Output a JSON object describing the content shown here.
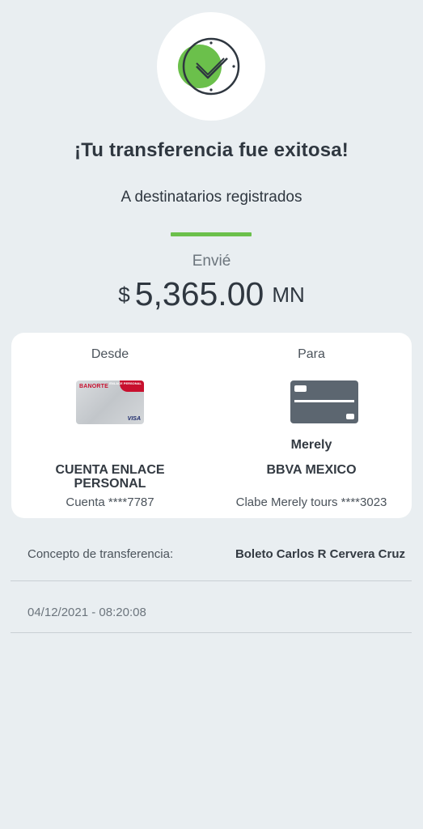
{
  "status": {
    "icon": "success-check-icon",
    "title": "¡Tu transferencia fue exitosa!",
    "subtitle": "A destinatarios registrados"
  },
  "amount": {
    "label": "Envié",
    "currency_symbol": "$",
    "value": "5,365.00",
    "unit": "MN"
  },
  "from": {
    "header": "Desde",
    "card_brand": "BANORTE",
    "card_ribbon": "ENLACE PERSONAL",
    "card_network": "VISA",
    "account_name": "CUENTA ENLACE PERSONAL",
    "account_number": "Cuenta ****7787"
  },
  "to": {
    "header": "Para",
    "card_icon": "generic-card-icon",
    "recipient_name": "Merely",
    "bank_name": "BBVA MEXICO",
    "clabe": "Clabe Merely tours ****3023"
  },
  "details": {
    "concept_label": "Concepto de transferencia:",
    "concept_value": "Boleto Carlos R Cervera Cruz",
    "datetime": "04/12/2021 - 08:20:08"
  },
  "colors": {
    "accent": "#6bc04b",
    "background": "#e9eef1",
    "card_background": "#ffffff",
    "text_primary": "#2f3740"
  }
}
